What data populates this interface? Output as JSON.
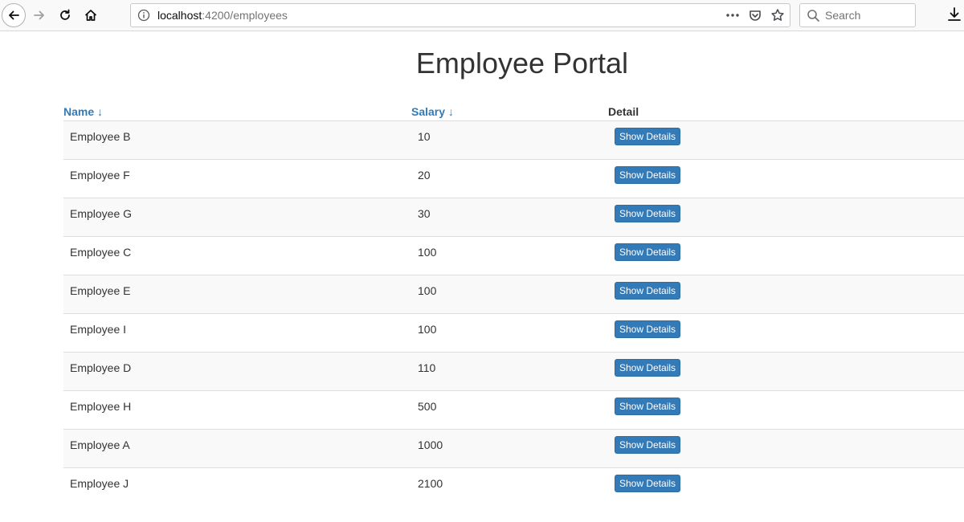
{
  "browser": {
    "url_host": "localhost",
    "url_path": ":4200/employees",
    "search_placeholder": "Search"
  },
  "page": {
    "title": "Employee Portal"
  },
  "table": {
    "headers": {
      "name": "Name ↓",
      "salary": "Salary ↓",
      "detail": "Detail"
    },
    "rows": [
      {
        "name": "Employee B",
        "salary": "10",
        "button": "Show Details"
      },
      {
        "name": "Employee F",
        "salary": "20",
        "button": "Show Details"
      },
      {
        "name": "Employee G",
        "salary": "30",
        "button": "Show Details"
      },
      {
        "name": "Employee C",
        "salary": "100",
        "button": "Show Details"
      },
      {
        "name": "Employee E",
        "salary": "100",
        "button": "Show Details"
      },
      {
        "name": "Employee I",
        "salary": "100",
        "button": "Show Details"
      },
      {
        "name": "Employee D",
        "salary": "110",
        "button": "Show Details"
      },
      {
        "name": "Employee H",
        "salary": "500",
        "button": "Show Details"
      },
      {
        "name": "Employee A",
        "salary": "1000",
        "button": "Show Details"
      },
      {
        "name": "Employee J",
        "salary": "2100",
        "button": "Show Details"
      }
    ]
  },
  "colors": {
    "link": "#337ab7",
    "button_bg": "#337ab7",
    "stripe": "#f9f9f9"
  }
}
